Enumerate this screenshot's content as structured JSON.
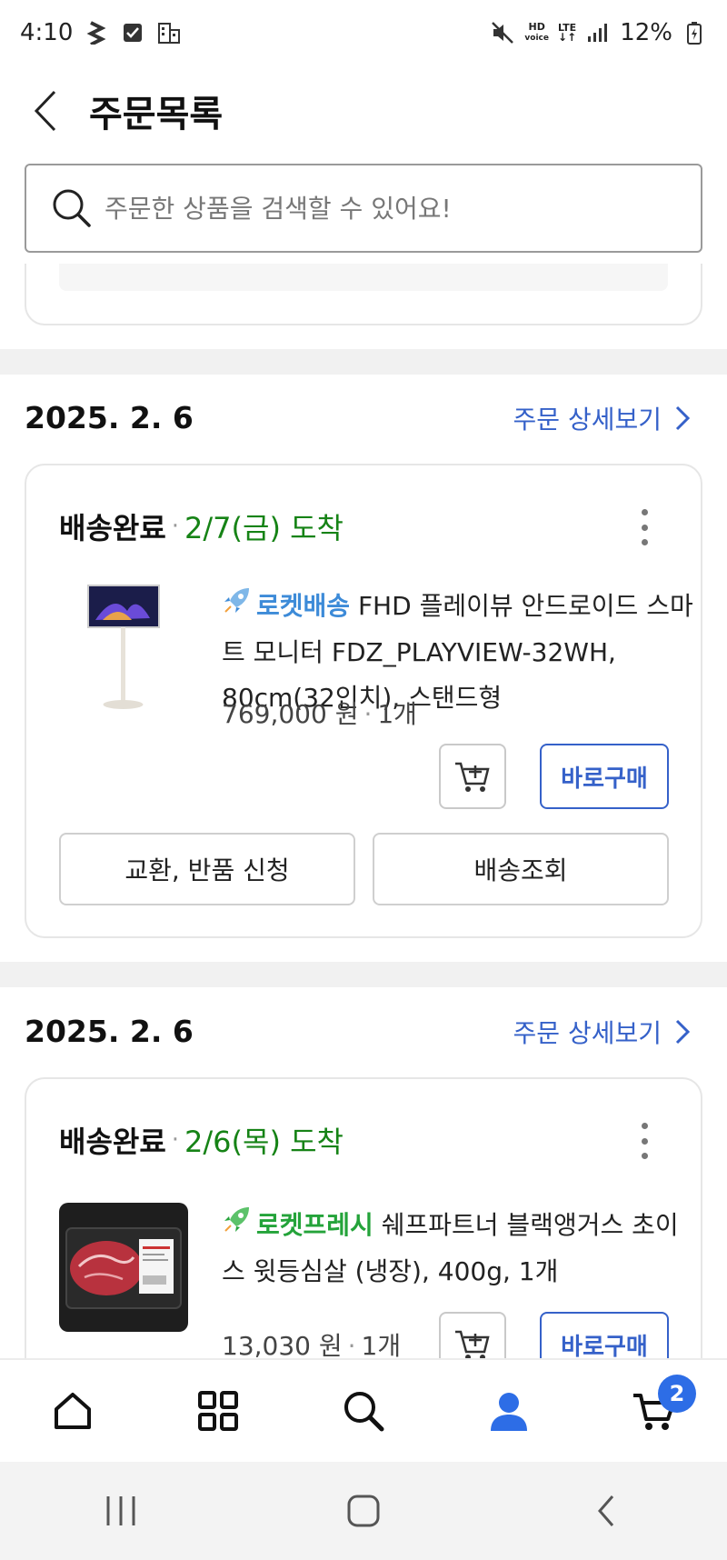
{
  "status_bar": {
    "time": "4:10",
    "battery": "12%",
    "hd_label": "HD",
    "voice_label": "voice",
    "lte_label": "LTE"
  },
  "header": {
    "title": "주문목록"
  },
  "search": {
    "placeholder": "주문한 상품을 검색할 수 있어요!"
  },
  "orders": [
    {
      "date": "2025. 2. 6",
      "detail_link": "주문 상세보기",
      "status": "배송완료",
      "separator": "·",
      "arrival": "2/7(금) 도착",
      "badge": "로켓배송",
      "product_name": "FHD 플레이뷰 안드로이드 스마트 모니터 FDZ_PLAYVIEW-32WH, 80cm(32인치), 스탠드형",
      "price": "769,000 원",
      "quantity": "1개",
      "buy_now": "바로구매",
      "exchange_button": "교환, 반품 신청",
      "tracking_button": "배송조회"
    },
    {
      "date": "2025. 2. 6",
      "detail_link": "주문 상세보기",
      "status": "배송완료",
      "separator": "·",
      "arrival": "2/6(목) 도착",
      "badge": "로켓프레시",
      "product_name": "쉐프파트너 블랙앵거스 초이스 윗등심살 (냉장), 400g, 1개",
      "price": "13,030 원",
      "quantity": "1개",
      "buy_now": "바로구매"
    }
  ],
  "bottom_nav": {
    "items": [
      "home-icon",
      "category-grid-icon",
      "search-icon",
      "my-page-icon",
      "cart-icon"
    ],
    "cart_count": "2"
  },
  "colors": {
    "accent_blue": "#3561c9",
    "arrival_green": "#168316",
    "rocket_blue": "#3d8bd8",
    "fresh_green": "#24a33a",
    "active_nav": "#2d6de6"
  }
}
